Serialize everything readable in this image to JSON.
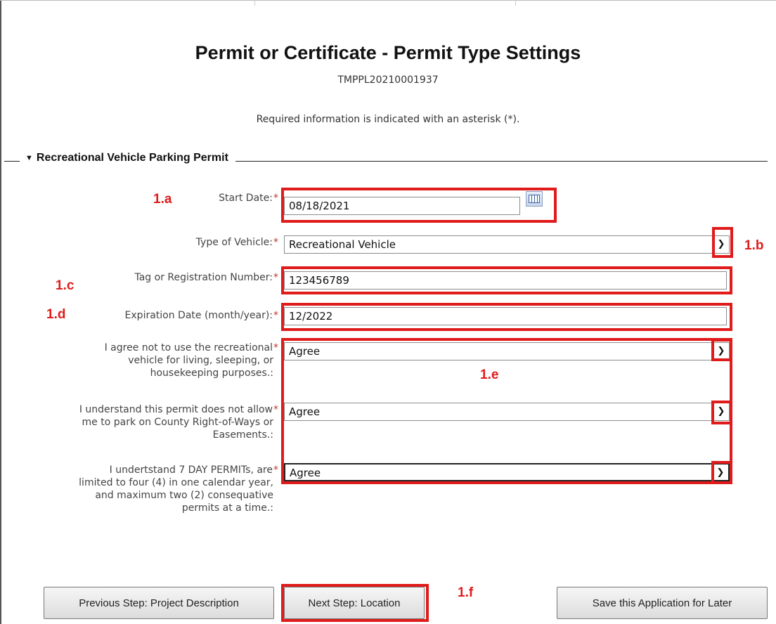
{
  "header": {
    "title": "Permit or Certificate - Permit Type Settings",
    "record_id": "TMPPL20210001937",
    "required_note": "Required information is indicated with an asterisk (*)."
  },
  "section": {
    "title": "Recreational Vehicle Parking Permit"
  },
  "form": {
    "required_marker": "*",
    "start_date": {
      "label": "Start Date:",
      "value": "08/18/2021"
    },
    "vehicle_type": {
      "label": "Type of Vehicle:",
      "value": "Recreational Vehicle"
    },
    "tag_number": {
      "label": "Tag or Registration Number:",
      "value": "123456789"
    },
    "expiration": {
      "label": "Expiration Date (month/year):",
      "value": "12/2022"
    },
    "agree_living": {
      "label_lines": [
        "I agree not to use the recreational",
        "vehicle for living, sleeping, or",
        "housekeeping purposes.:"
      ],
      "value": "Agree"
    },
    "agree_row": {
      "label_lines": [
        "I understand this permit does not allow",
        "me to park on County Right-of-Ways or",
        "Easements.:"
      ],
      "value": "Agree"
    },
    "agree_7day": {
      "label_lines": [
        "I undertstand 7 DAY PERMITs, are",
        "limited to four (4) in one calendar year,",
        "and maximum two (2) consequative",
        "permits at a time.:"
      ],
      "value": "Agree"
    }
  },
  "annotations": {
    "a": "1.a",
    "b": "1.b",
    "c": "1.c",
    "d": "1.d",
    "e": "1.e",
    "f": "1.f"
  },
  "buttons": {
    "previous": "Previous Step: Project Description",
    "next": "Next Step: Location",
    "save": "Save this Application for Later"
  },
  "colors": {
    "annotation_red": "#e01b1b",
    "required_asterisk": "#c0392b"
  }
}
